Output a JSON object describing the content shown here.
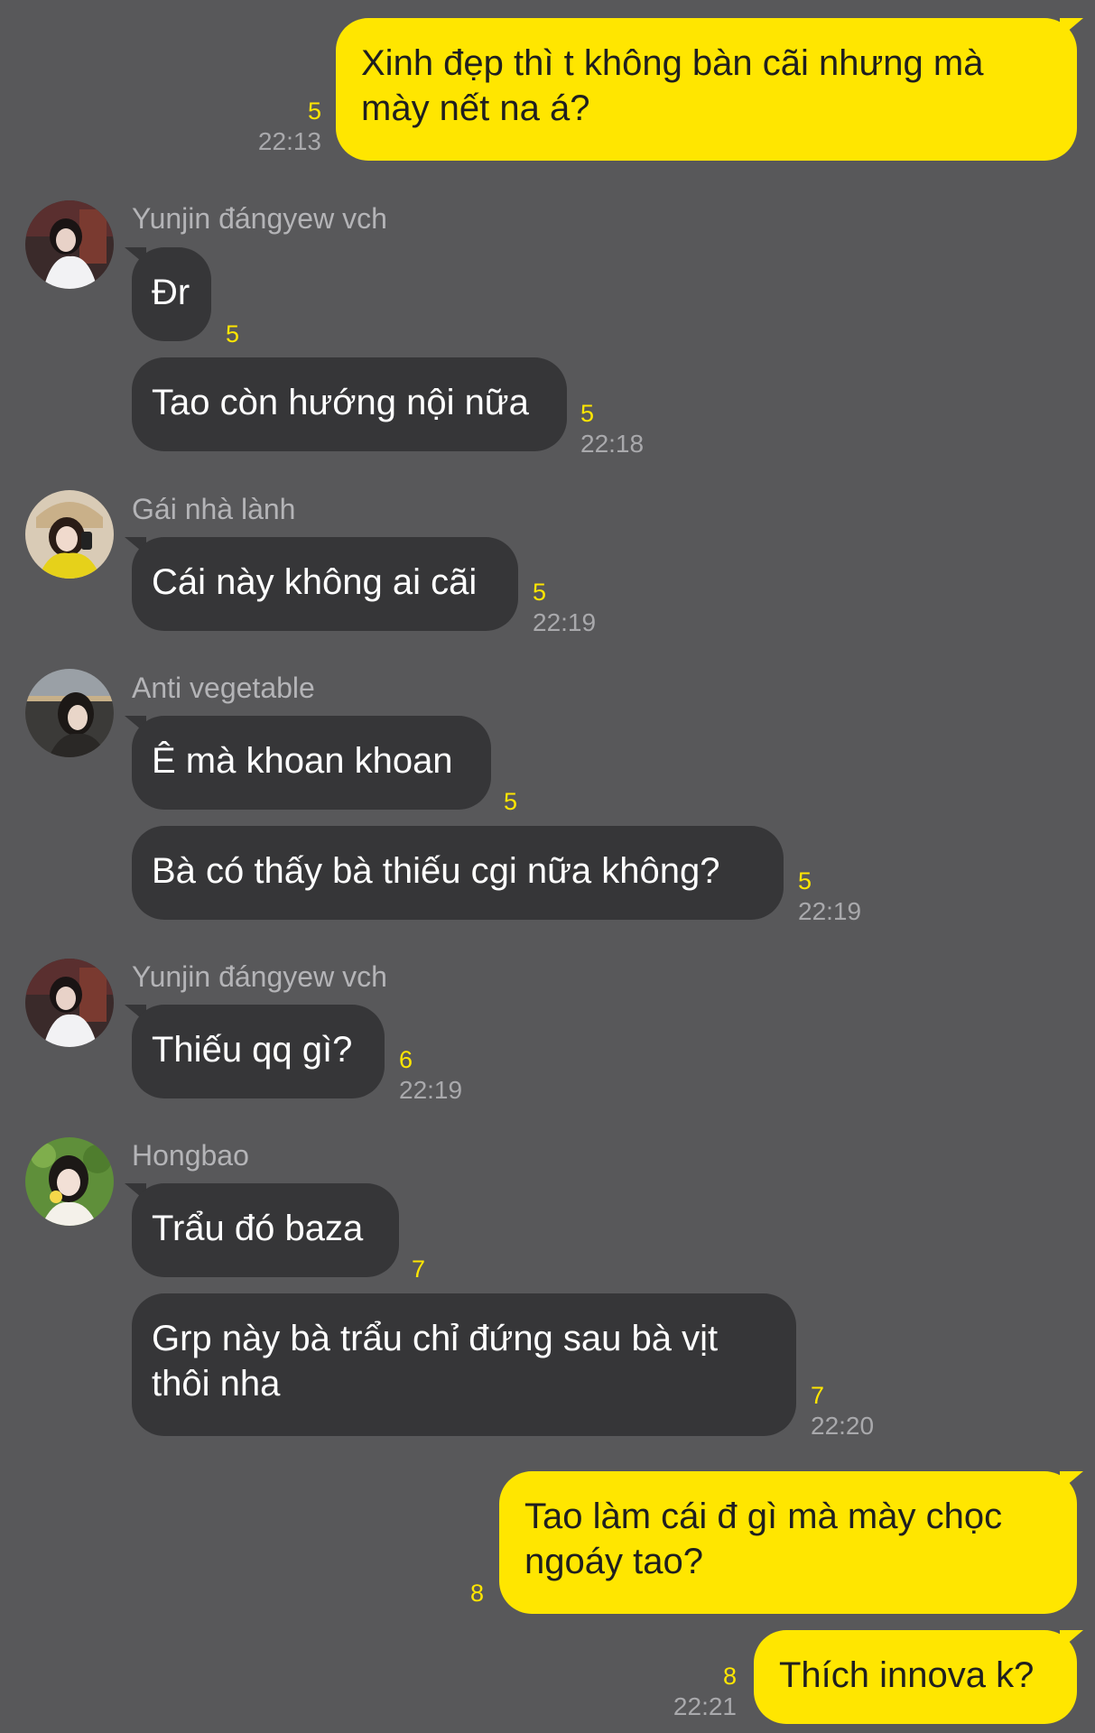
{
  "colors": {
    "background": "#58585a",
    "incoming_bubble": "#363638",
    "outgoing_bubble": "#ffe600",
    "unread_count": "#ffe600",
    "timestamp": "#a9a9ac",
    "sender_name": "#b4b4b7"
  },
  "messages": [
    {
      "side": "out",
      "text": "Xinh đẹp thì t không bàn cãi nhưng mà mày nết na á?",
      "count": "5",
      "time": "22:13"
    },
    {
      "side": "in",
      "sender": "Yunjin đángyew vch",
      "avatar": "avatar-yunjin",
      "text": "Đr",
      "count": "5",
      "time": ""
    },
    {
      "side": "in",
      "text": "Tao còn hướng nội nữa",
      "count": "5",
      "time": "22:18"
    },
    {
      "side": "in",
      "sender": "Gái nhà lành",
      "avatar": "avatar-gai-nha-lanh",
      "text": "Cái này không ai cãi",
      "count": "5",
      "time": "22:19"
    },
    {
      "side": "in",
      "sender": "Anti vegetable",
      "avatar": "avatar-anti-vegetable",
      "text": "Ê mà khoan khoan",
      "count": "5",
      "time": ""
    },
    {
      "side": "in",
      "text": "Bà có thấy bà thiếu cgi nữa không?",
      "count": "5",
      "time": "22:19"
    },
    {
      "side": "in",
      "sender": "Yunjin đángyew vch",
      "avatar": "avatar-yunjin",
      "text": "Thiếu qq gì?",
      "count": "6",
      "time": "22:19"
    },
    {
      "side": "in",
      "sender": "Hongbao",
      "avatar": "avatar-hongbao",
      "text": "Trẩu đó baza",
      "count": "7",
      "time": ""
    },
    {
      "side": "in",
      "text": "Grp này bà trẩu chỉ đứng sau bà vịt thôi nha",
      "count": "7",
      "time": "22:20"
    },
    {
      "side": "out",
      "text": "Tao làm cái đ gì mà mày chọc ngoáy tao?",
      "count": "8",
      "time": ""
    },
    {
      "side": "out",
      "text": "Thích innova k?",
      "count": "8",
      "time": "22:21"
    }
  ]
}
